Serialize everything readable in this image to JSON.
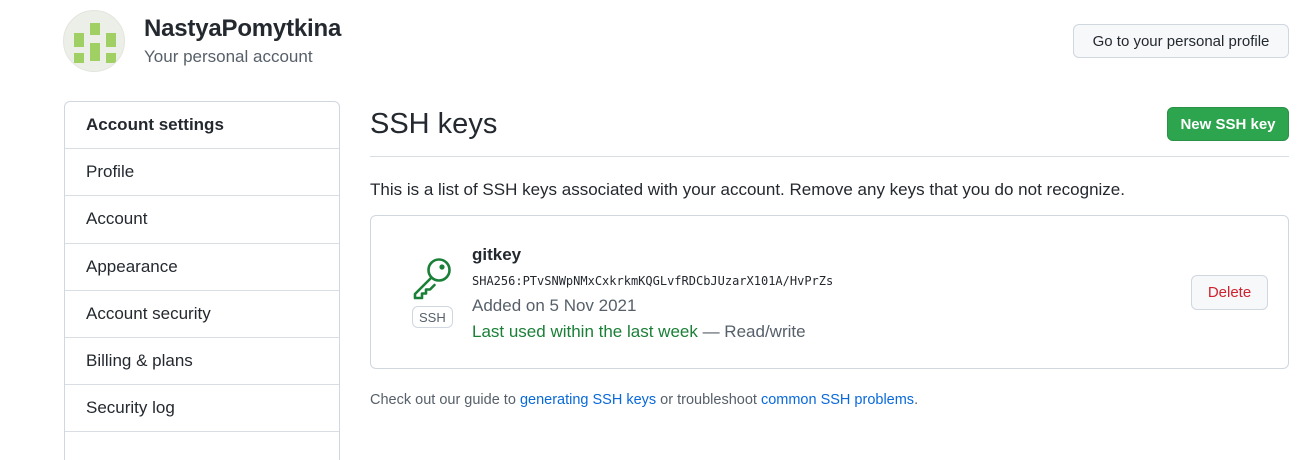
{
  "user": {
    "name": "NastyaPomytkina",
    "subtitle": "Your personal account",
    "avatar_color": "#a0cf64"
  },
  "header": {
    "profile_button": "Go to your personal profile"
  },
  "sidebar": {
    "heading": "Account settings",
    "items": [
      {
        "label": "Profile"
      },
      {
        "label": "Account"
      },
      {
        "label": "Appearance"
      },
      {
        "label": "Account security"
      },
      {
        "label": "Billing & plans"
      },
      {
        "label": "Security log"
      }
    ]
  },
  "main": {
    "title": "SSH keys",
    "new_key_button": "New SSH key",
    "intro": "This is a list of SSH keys associated with your account. Remove any keys that you do not recognize.",
    "keys": [
      {
        "icon": "key-icon",
        "type_label": "SSH",
        "title": "gitkey",
        "fingerprint": "SHA256:PTvSNWpNMxCxkrkmKQGLvfRDCbJUzarX101A/HvPrZs",
        "added": "Added on 5 Nov 2021",
        "last_used": "Last used within the last week",
        "access": " — Read/write",
        "delete_label": "Delete"
      }
    ],
    "guide": {
      "prefix": "Check out our guide to ",
      "link1": "generating SSH keys",
      "middle": " or troubleshoot ",
      "link2": "common SSH problems",
      "suffix": "."
    }
  },
  "colors": {
    "accent_green": "#2da44e",
    "link_blue": "#0969da",
    "danger_red": "#cf222e",
    "success_text": "#1a7f37"
  }
}
